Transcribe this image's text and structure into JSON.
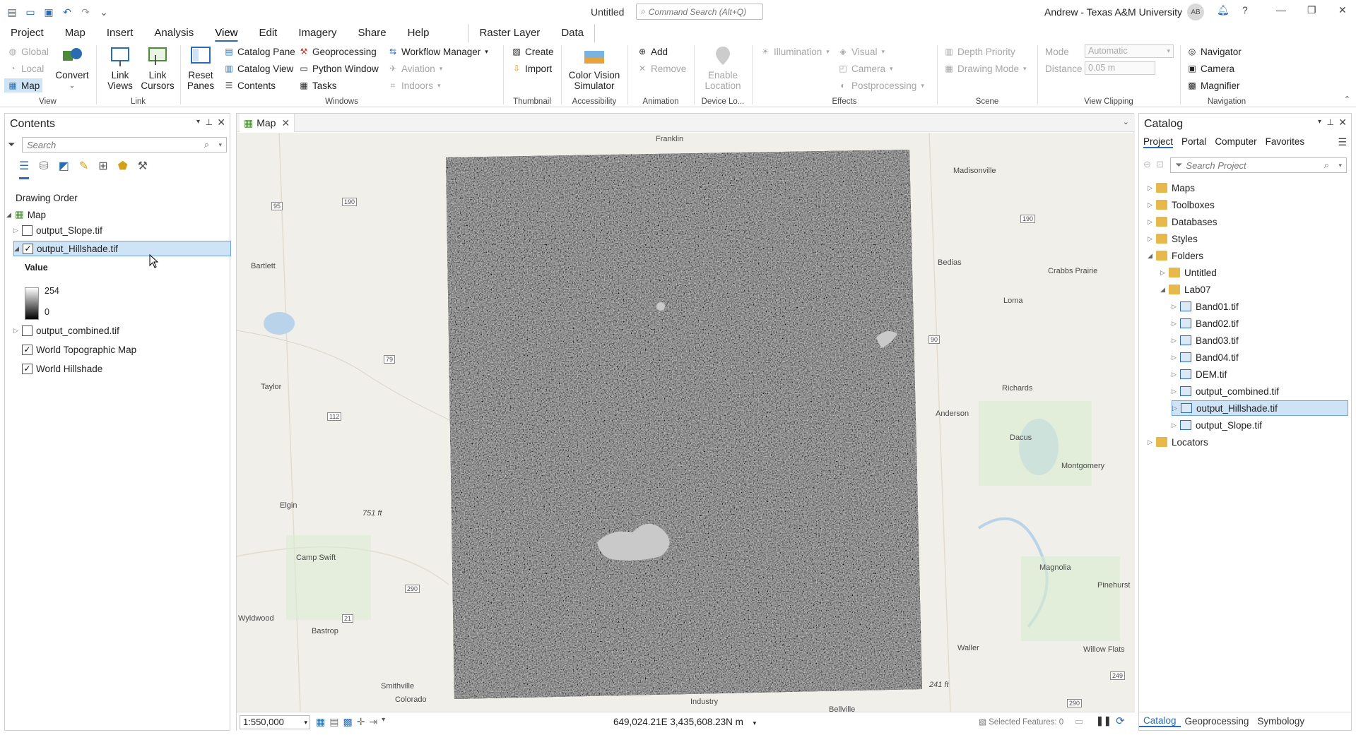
{
  "window": {
    "title": "Untitled",
    "command_search_placeholder": "Command Search (Alt+Q)",
    "user": "Andrew - Texas A&M University",
    "avatar": "AB"
  },
  "tabs": [
    "Project",
    "Map",
    "Insert",
    "Analysis",
    "View",
    "Edit",
    "Imagery",
    "Share",
    "Help"
  ],
  "context_tabs": [
    "Raster Layer",
    "Data"
  ],
  "ribbon": {
    "view_group": {
      "label": "View",
      "global": "Global",
      "local": "Local",
      "map": "Map",
      "convert": "Convert"
    },
    "link_group": {
      "label": "Link",
      "link_views": "Link Views",
      "link_cursors": "Link Cursors"
    },
    "windows_group": {
      "label": "Windows",
      "reset_panes": "Reset Panes",
      "catalog_pane": "Catalog Pane",
      "catalog_view": "Catalog View",
      "contents": "Contents",
      "geoprocessing": "Geoprocessing",
      "python_window": "Python Window",
      "tasks": "Tasks",
      "workflow_manager": "Workflow Manager",
      "aviation": "Aviation",
      "indoors": "Indoors"
    },
    "thumbnail_group": {
      "label": "Thumbnail",
      "create": "Create",
      "import": "Import"
    },
    "accessibility_group": {
      "label": "Accessibility",
      "color_vision": "Color Vision Simulator"
    },
    "animation_group": {
      "label": "Animation",
      "add": "Add",
      "remove": "Remove"
    },
    "device_group": {
      "label": "Device Lo...",
      "enable_location": "Enable Location"
    },
    "effects_group": {
      "label": "Effects",
      "illumination": "Illumination",
      "visual": "Visual",
      "camera": "Camera",
      "postprocessing": "Postprocessing"
    },
    "scene_group": {
      "label": "Scene",
      "depth_priority": "Depth Priority",
      "drawing_mode": "Drawing Mode"
    },
    "clipping_group": {
      "label": "View Clipping",
      "mode_label": "Mode",
      "mode_value": "Automatic",
      "distance_label": "Distance",
      "distance_value": "0.05  m"
    },
    "navigation_group": {
      "label": "Navigation",
      "navigator": "Navigator",
      "camera": "Camera",
      "magnifier": "Magnifier"
    }
  },
  "contents": {
    "title": "Contents",
    "search_placeholder": "Search",
    "drawing_order": "Drawing Order",
    "map_node": "Map",
    "layers": [
      {
        "name": "output_Slope.tif",
        "checked": false
      },
      {
        "name": "output_Hillshade.tif",
        "checked": true
      },
      {
        "name": "output_combined.tif",
        "checked": false
      },
      {
        "name": "World Topographic Map",
        "checked": true
      },
      {
        "name": "World Hillshade",
        "checked": true
      }
    ],
    "legend": {
      "title": "Value",
      "high": "254",
      "low": "0"
    }
  },
  "map": {
    "tab_label": "Map",
    "scale": "1:550,000",
    "coordinates": "649,024.21E 3,435,608.23N m",
    "selected_features": "Selected Features: 0",
    "places": [
      "Franklin",
      "Madisonville",
      "Bartlett",
      "Bedias",
      "Crabbs Prairie",
      "Loma",
      "Taylor",
      "Richards",
      "Anderson",
      "Dacus",
      "Montgomery",
      "Elgin",
      "Camp Swift",
      "Magnolia",
      "Pinehurst",
      "Wyldwood",
      "Bastrop",
      "Waller",
      "Willow Flats",
      "Smithville",
      "Colorado",
      "Industry",
      "Bellville",
      "751 ft",
      "241 ft"
    ],
    "roads": [
      "95",
      "190",
      "79",
      "112",
      "21",
      "290",
      "90",
      "190",
      "249",
      "290"
    ]
  },
  "catalog": {
    "title": "Catalog",
    "tabs": [
      "Project",
      "Portal",
      "Computer",
      "Favorites"
    ],
    "search_placeholder": "Search Project",
    "items": [
      "Maps",
      "Toolboxes",
      "Databases",
      "Styles",
      "Folders"
    ],
    "folders": [
      "Untitled",
      "Lab07"
    ],
    "files": [
      "Band01.tif",
      "Band02.tif",
      "Band03.tif",
      "Band04.tif",
      "DEM.tif",
      "output_combined.tif",
      "output_Hillshade.tif",
      "output_Slope.tif"
    ],
    "locators": "Locators",
    "bottom_tabs": [
      "Catalog",
      "Geoprocessing",
      "Symbology"
    ]
  }
}
